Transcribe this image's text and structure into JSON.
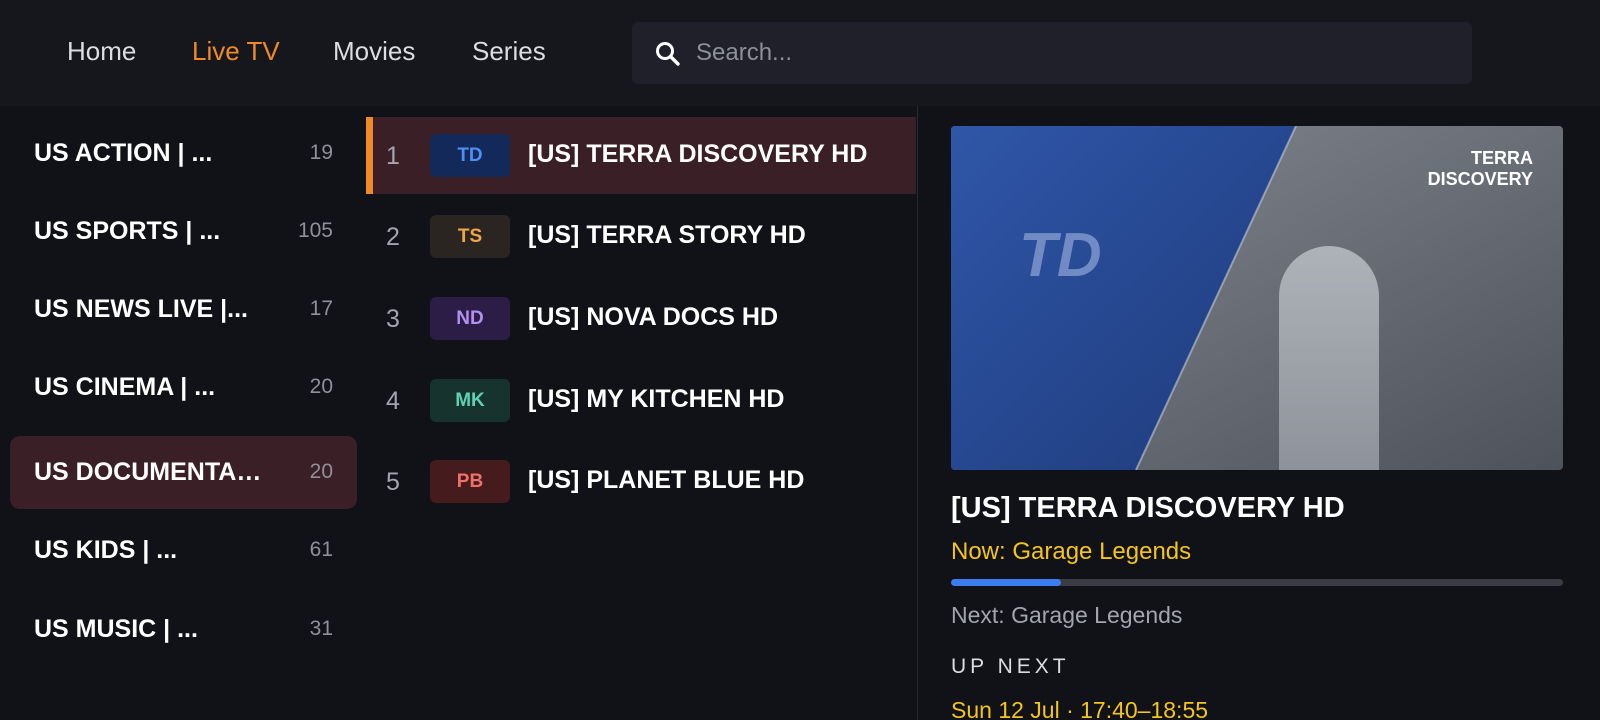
{
  "nav": {
    "tabs": [
      {
        "label": "Home",
        "active": false
      },
      {
        "label": "Live TV",
        "active": true
      },
      {
        "label": "Movies",
        "active": false
      },
      {
        "label": "Series",
        "active": false
      }
    ]
  },
  "search": {
    "placeholder": "Search...",
    "value": "",
    "icon": "search-icon"
  },
  "categories": [
    {
      "name": "US ACTION | ...",
      "count": "19"
    },
    {
      "name": "US SPORTS | ...",
      "count": "105"
    },
    {
      "name": "US NEWS LIVE |...",
      "count": "17"
    },
    {
      "name": "US CINEMA | ...",
      "count": "20"
    },
    {
      "name": "US DOCUMENTAR...",
      "count": "20",
      "selected": true
    },
    {
      "name": "US KIDS | ...",
      "count": "61"
    },
    {
      "name": "US MUSIC | ...",
      "count": "31"
    }
  ],
  "channels": [
    {
      "number": "1",
      "logo": "TD",
      "name": "[US] TERRA DISCOVERY HD",
      "logo_bg": "#12295a",
      "logo_fg": "#4f8ef5",
      "selected": true
    },
    {
      "number": "2",
      "logo": "TS",
      "name": "[US] TERRA STORY HD",
      "logo_bg": "#2a2520",
      "logo_fg": "#f0a548"
    },
    {
      "number": "3",
      "logo": "ND",
      "name": "[US] NOVA DOCS HD",
      "logo_bg": "#2b1d45",
      "logo_fg": "#b48ff0"
    },
    {
      "number": "4",
      "logo": "MK",
      "name": "[US] MY KITCHEN HD",
      "logo_bg": "#16332d",
      "logo_fg": "#5fd1b5"
    },
    {
      "number": "5",
      "logo": "PB",
      "name": "[US] PLANET BLUE HD",
      "logo_bg": "#461b1d",
      "logo_fg": "#f0706c"
    }
  ],
  "preview": {
    "brand": "TERRA\nDISCOVERY",
    "watermark": "TD"
  },
  "details": {
    "title": "[US] TERRA DISCOVERY HD",
    "now": "Now: Garage Legends",
    "progress": 0.18,
    "next": "Next: Garage Legends",
    "upnext_label": "UP NEXT",
    "upnext_time": "Sun 12 Jul · 17:40–18:55"
  },
  "colors": {
    "accent": "#f08a24",
    "now_text": "#f5c518",
    "progress": "#3d7cf0",
    "selection_bg": "#3a1f26"
  }
}
